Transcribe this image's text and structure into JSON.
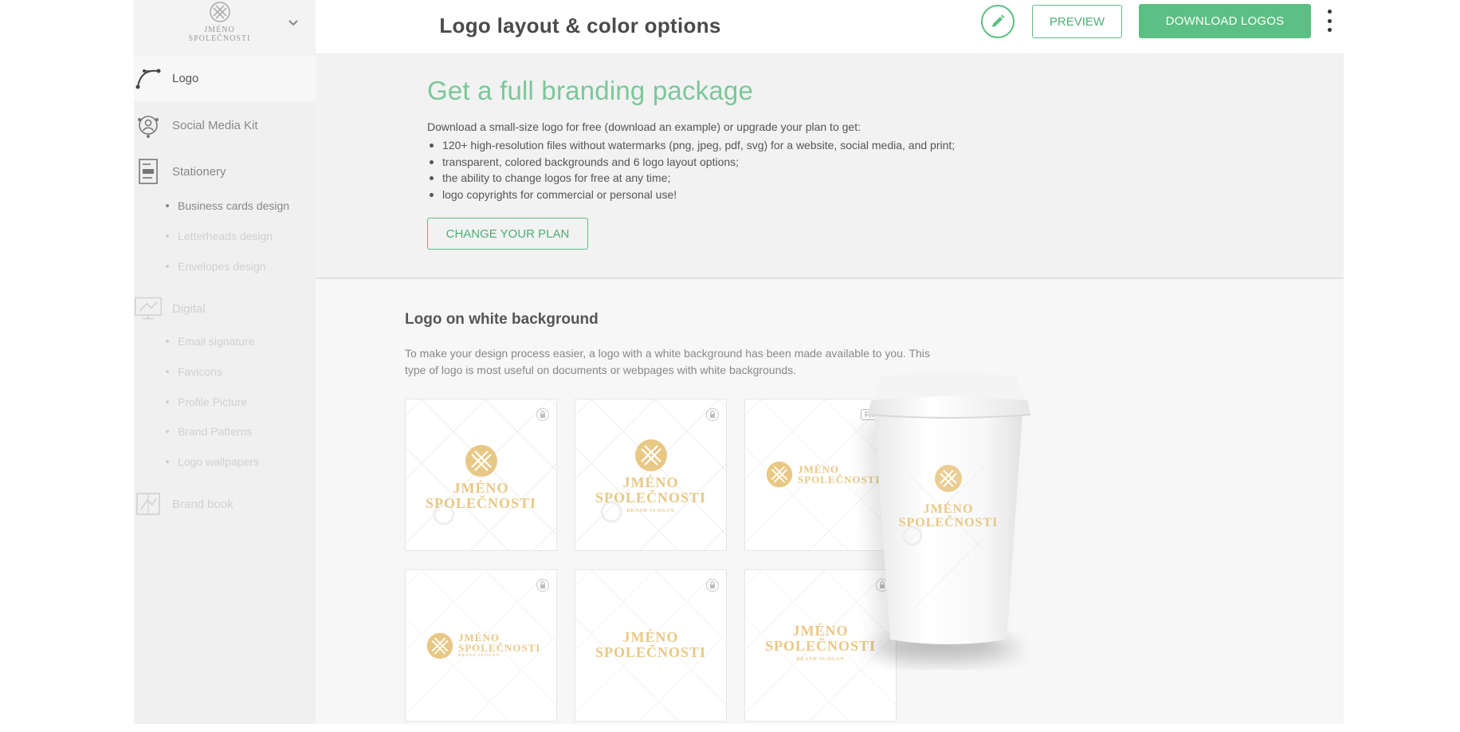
{
  "header": {
    "title": "Logo layout & color options",
    "preview_label": "PREVIEW",
    "download_label": "DOWNLOAD LOGOS",
    "brand_line1": "JMÉNO",
    "brand_line2": "SPOLEČNOSTI"
  },
  "sidebar": {
    "items": [
      {
        "label": "Logo",
        "icon": "bezier-pen-icon"
      },
      {
        "label": "Social Media Kit",
        "icon": "social-kit-icon"
      },
      {
        "label": "Stationery",
        "icon": "stationery-icon"
      },
      {
        "label": "Digital",
        "icon": "monitor-icon"
      },
      {
        "label": "Brand book",
        "icon": "brand-book-icon"
      }
    ],
    "stationery_sub": [
      "Business cards design",
      "Letterheads design",
      "Envelopes design"
    ],
    "digital_sub": [
      "Email signature",
      "Favicons",
      "Profile Picture",
      "Brand Patterns",
      "Logo wallpapers"
    ]
  },
  "promo": {
    "title": "Get a full branding package",
    "intro": "Download a small-size logo for free (download an example) or upgrade your plan to get:",
    "bullets": [
      "120+ high-resolution files without watermarks (png, jpeg, pdf, svg) for a website, social media, and print;",
      "transparent, colored backgrounds and 6 logo layout options;",
      "the ability to change logos for free at any time;",
      "logo copyrights for commercial or personal use!"
    ],
    "button_label": "CHANGE YOUR PLAN"
  },
  "section": {
    "title": "Logo on white background",
    "description": "To make your design process easier, a logo with a white background has been made available to you. This type of logo is most useful on documents or webpages with white backgrounds."
  },
  "logo": {
    "name_line1": "JMÉNO",
    "name_line2": "SPOLEČNOSTI",
    "tagline": "BRAND SLOGAN",
    "color": "#e8c885"
  },
  "tiles": [
    {
      "layout": "icon-top",
      "badge": "lock-icon"
    },
    {
      "layout": "icon-top-tagline",
      "badge": "lock-icon"
    },
    {
      "layout": "icon-left",
      "badge": "FREE"
    },
    {
      "layout": "icon-left-tagline",
      "badge": "lock-icon"
    },
    {
      "layout": "text-only",
      "badge": "lock-icon"
    },
    {
      "layout": "text-only-tagline",
      "badge": "lock-icon"
    }
  ],
  "colors": {
    "accent": "#5cbf83",
    "promo_title": "#7cc79b",
    "logo_gold": "#e8c885"
  }
}
